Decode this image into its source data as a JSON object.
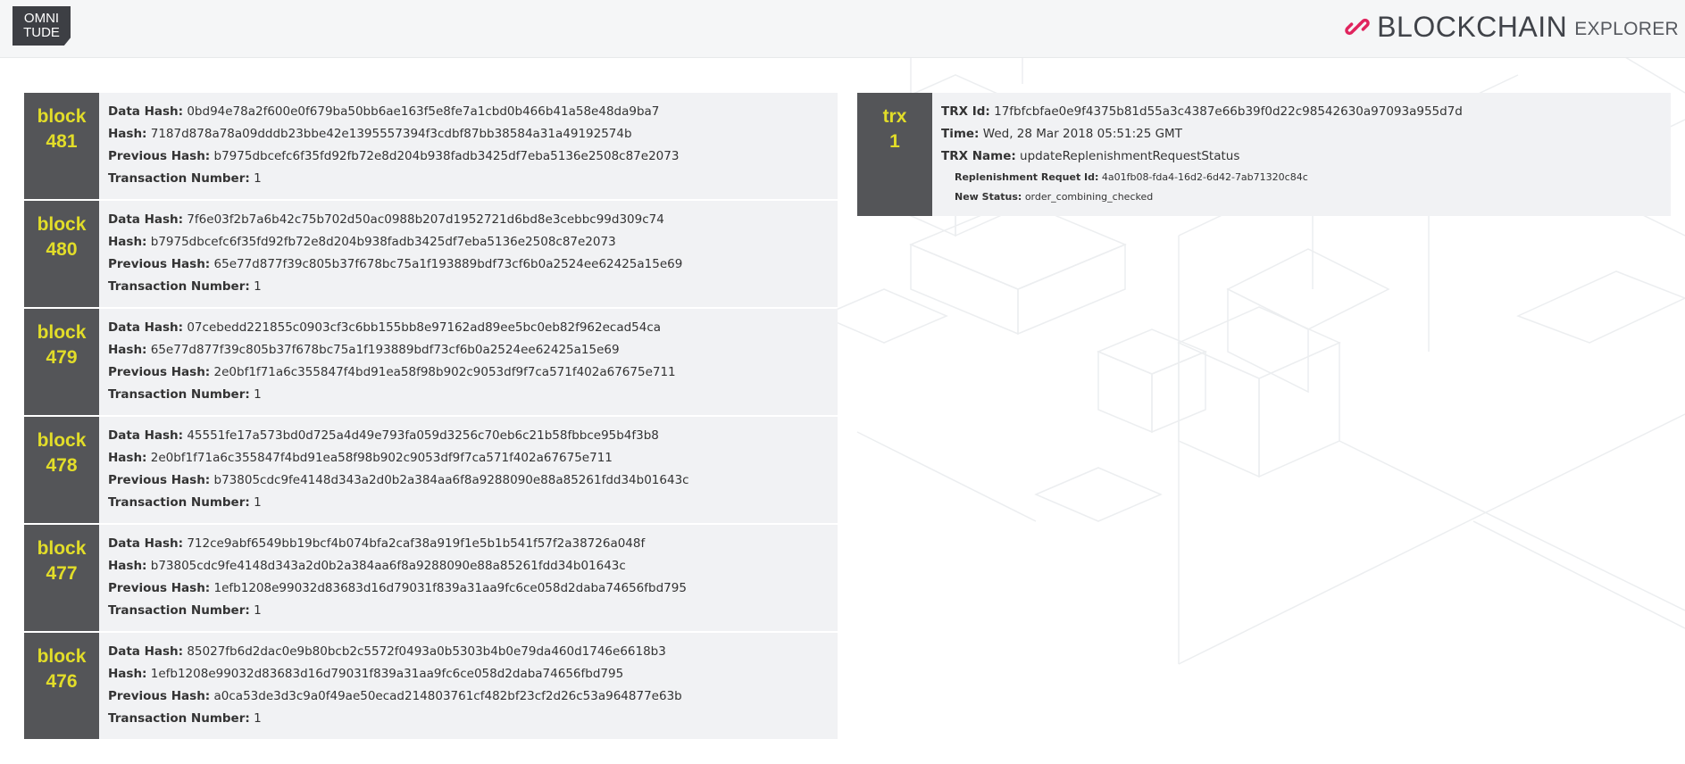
{
  "header": {
    "logo_line1": "OMNI",
    "logo_line2": "TUDE",
    "title_main": "BLOCKCHAIN",
    "title_sub": "EXPLORER",
    "link_icon_color": "#e0245e"
  },
  "labels": {
    "data_hash": "Data Hash:",
    "hash": "Hash:",
    "previous_hash": "Previous Hash:",
    "transaction_number": "Transaction Number:",
    "trx_id": "TRX Id:",
    "time": "Time:",
    "trx_name": "TRX Name:",
    "replenishment_id": "Replenishment Requet Id:",
    "new_status": "New Status:"
  },
  "blocks": [
    {
      "tag": "block",
      "number": "481",
      "data_hash": "0bd94e78a2f600e0f679ba50bb6ae163f5e8fe7a1cbd0b466b41a58e48da9ba7",
      "hash": "7187d878a78a09dddb23bbe42e1395557394f3cdbf87bb38584a31a49192574b",
      "previous_hash": "b7975dbcefc6f35fd92fb72e8d204b938fadb3425df7eba5136e2508c87e2073",
      "transaction_number": "1"
    },
    {
      "tag": "block",
      "number": "480",
      "data_hash": "7f6e03f2b7a6b42c75b702d50ac0988b207d1952721d6bd8e3cebbc99d309c74",
      "hash": "b7975dbcefc6f35fd92fb72e8d204b938fadb3425df7eba5136e2508c87e2073",
      "previous_hash": "65e77d877f39c805b37f678bc75a1f193889bdf73cf6b0a2524ee62425a15e69",
      "transaction_number": "1"
    },
    {
      "tag": "block",
      "number": "479",
      "data_hash": "07cebedd221855c0903cf3c6bb155bb8e97162ad89ee5bc0eb82f962ecad54ca",
      "hash": "65e77d877f39c805b37f678bc75a1f193889bdf73cf6b0a2524ee62425a15e69",
      "previous_hash": "2e0bf1f71a6c355847f4bd91ea58f98b902c9053df9f7ca571f402a67675e711",
      "transaction_number": "1"
    },
    {
      "tag": "block",
      "number": "478",
      "data_hash": "45551fe17a573bd0d725a4d49e793fa059d3256c70eb6c21b58fbbce95b4f3b8",
      "hash": "2e0bf1f71a6c355847f4bd91ea58f98b902c9053df9f7ca571f402a67675e711",
      "previous_hash": "b73805cdc9fe4148d343a2d0b2a384aa6f8a9288090e88a85261fdd34b01643c",
      "transaction_number": "1"
    },
    {
      "tag": "block",
      "number": "477",
      "data_hash": "712ce9abf6549bb19bcf4b074bfa2caf38a919f1e5b1b541f57f2a38726a048f",
      "hash": "b73805cdc9fe4148d343a2d0b2a384aa6f8a9288090e88a85261fdd34b01643c",
      "previous_hash": "1efb1208e99032d83683d16d79031f839a31aa9fc6ce058d2daba74656fbd795",
      "transaction_number": "1"
    },
    {
      "tag": "block",
      "number": "476",
      "data_hash": "85027fb6d2dac0e9b80bcb2c5572f0493a0b5303b4b0e79da460d1746e6618b3",
      "hash": "1efb1208e99032d83683d16d79031f839a31aa9fc6ce058d2daba74656fbd795",
      "previous_hash": "a0ca53de3d3c9a0f49ae50ecad214803761cf482bf23cf2d26c53a964877e63b",
      "transaction_number": "1"
    }
  ],
  "transactions": [
    {
      "tag": "trx",
      "number": "1",
      "trx_id": "17fbfcbfae0e9f4375b81d55a3c4387e66b39f0d22c98542630a97093a955d7d",
      "time": "Wed, 28 Mar 2018 05:51:25 GMT",
      "trx_name": "updateReplenishmentRequestStatus",
      "replenishment_id": "4a01fb08-fda4-16d2-6d42-7ab71320c84c",
      "new_status": "order_combining_checked"
    }
  ],
  "colors": {
    "tag_bg": "#545558",
    "tag_text": "#e2dd29",
    "card_bg": "#f1f2f4",
    "header_bg": "#f5f6f7"
  }
}
